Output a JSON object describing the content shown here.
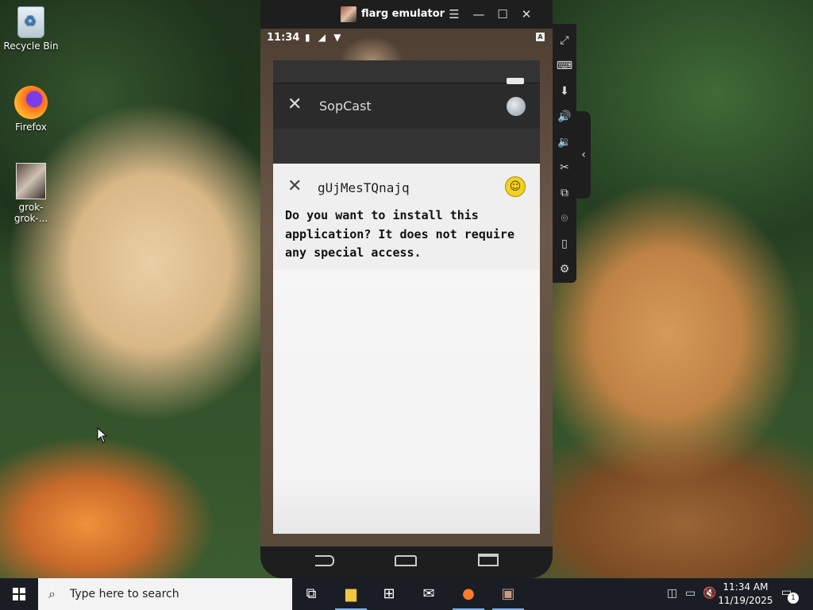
{
  "desktop": {
    "icons": [
      {
        "label": "Recycle Bin"
      },
      {
        "label": "Firefox"
      },
      {
        "label": "grok-grok-..."
      }
    ]
  },
  "emulator": {
    "title": "flarg emulator",
    "status": {
      "time": "11:34",
      "right_badge": "A"
    },
    "app": {
      "title": "SopCast"
    },
    "dialog": {
      "title": "gUjMesTQnajq",
      "message": "Do you want to install this application? It does not require any special access."
    }
  },
  "taskbar": {
    "search_placeholder": "Type here to search",
    "clock_time": "11:34 AM",
    "clock_date": "11/19/2025",
    "notification_count": "1"
  },
  "icons": [
    "recycle-bin-icon",
    "firefox-icon",
    "file-explorer-icon",
    "store-icon",
    "mail-icon",
    "task-view-icon",
    "volume-icon",
    "network-icon",
    "notification-icon"
  ]
}
